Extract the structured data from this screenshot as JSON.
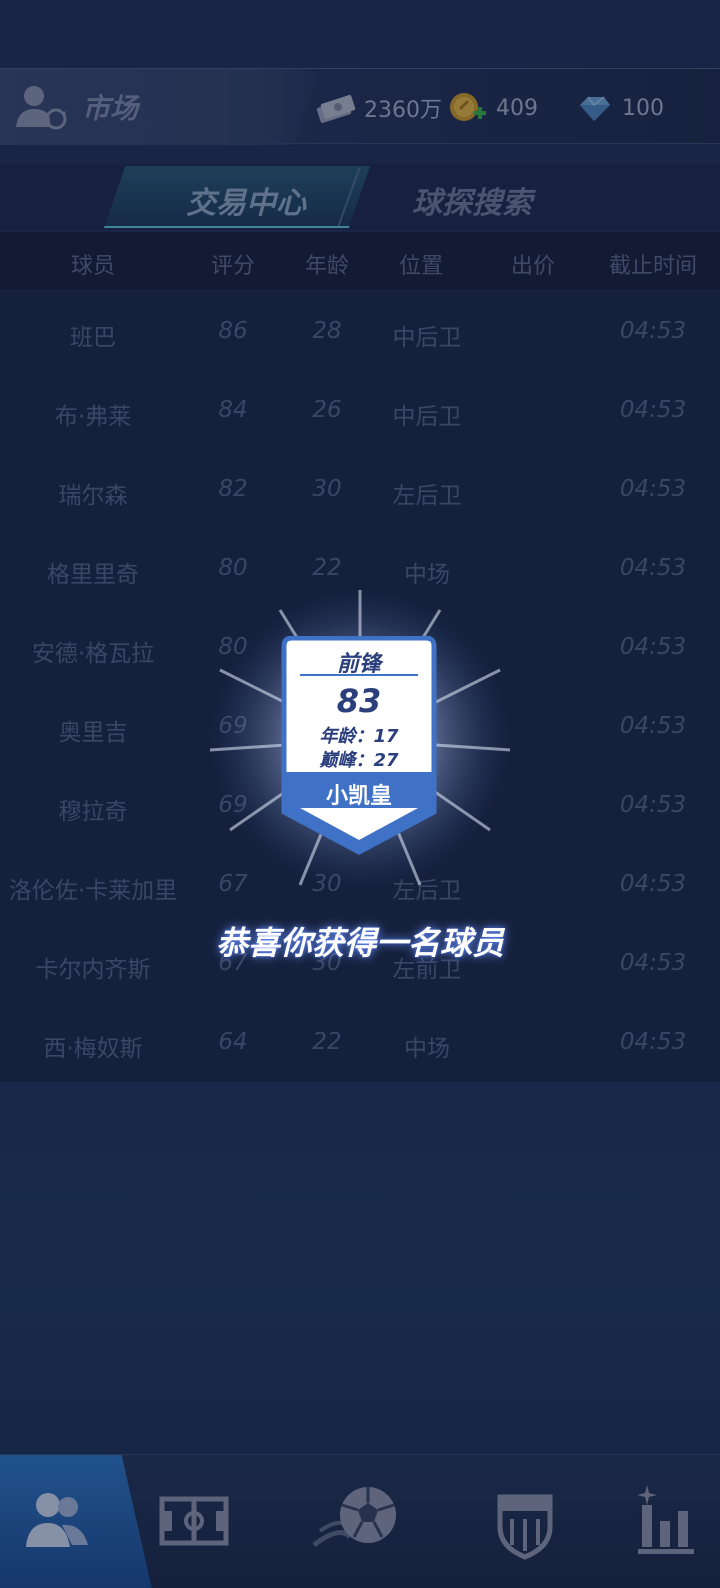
{
  "header": {
    "title": "市场",
    "money": "2360万",
    "coins": "409",
    "gems": "100"
  },
  "tabs": [
    {
      "label": "交易中心",
      "active": true
    },
    {
      "label": "球探搜索",
      "active": false
    }
  ],
  "table": {
    "columns": [
      "球员",
      "评分",
      "年龄",
      "位置",
      "出价",
      "截止时间"
    ],
    "rows": [
      {
        "name": "班巴",
        "score": "86",
        "age": "28",
        "pos": "中后卫",
        "bid": "",
        "time": "04:53"
      },
      {
        "name": "布·弗莱",
        "score": "84",
        "age": "26",
        "pos": "中后卫",
        "bid": "",
        "time": "04:53"
      },
      {
        "name": "瑞尔森",
        "score": "82",
        "age": "30",
        "pos": "左后卫",
        "bid": "",
        "time": "04:53"
      },
      {
        "name": "格里里奇",
        "score": "80",
        "age": "22",
        "pos": "中场",
        "bid": "",
        "time": "04:53"
      },
      {
        "name": "安德·格瓦拉",
        "score": "80",
        "age": "",
        "pos": "",
        "bid": "",
        "time": "04:53"
      },
      {
        "name": "奥里吉",
        "score": "69",
        "age": "",
        "pos": "",
        "bid": "",
        "time": "04:53"
      },
      {
        "name": "穆拉奇",
        "score": "69",
        "age": "",
        "pos": "",
        "bid": "",
        "time": "04:53"
      },
      {
        "name": "洛伦佐·卡莱加里",
        "score": "67",
        "age": "30",
        "pos": "左后卫",
        "bid": "",
        "time": "04:53"
      },
      {
        "name": "卡尔内齐斯",
        "score": "67",
        "age": "30",
        "pos": "左前卫",
        "bid": "",
        "time": "04:53"
      },
      {
        "name": "西·梅奴斯",
        "score": "64",
        "age": "22",
        "pos": "中场",
        "bid": "",
        "time": "04:53"
      }
    ]
  },
  "reward": {
    "position": "前锋",
    "rating": "83",
    "age_label": "年龄：17",
    "peak_label": "巅峰：27",
    "name": "小凯皇",
    "message": "恭喜你获得一名球员"
  },
  "nav": {
    "items": [
      {
        "icon": "players-icon",
        "active": true
      },
      {
        "icon": "pitch-icon",
        "active": false
      },
      {
        "icon": "soccer-ball-icon",
        "active": false
      },
      {
        "icon": "club-badge-icon",
        "active": false
      },
      {
        "icon": "stats-icon",
        "active": false
      }
    ]
  },
  "colors": {
    "background": "#1f2f58",
    "accent": "#2f77c6",
    "card_text": "#2b3f7c"
  }
}
